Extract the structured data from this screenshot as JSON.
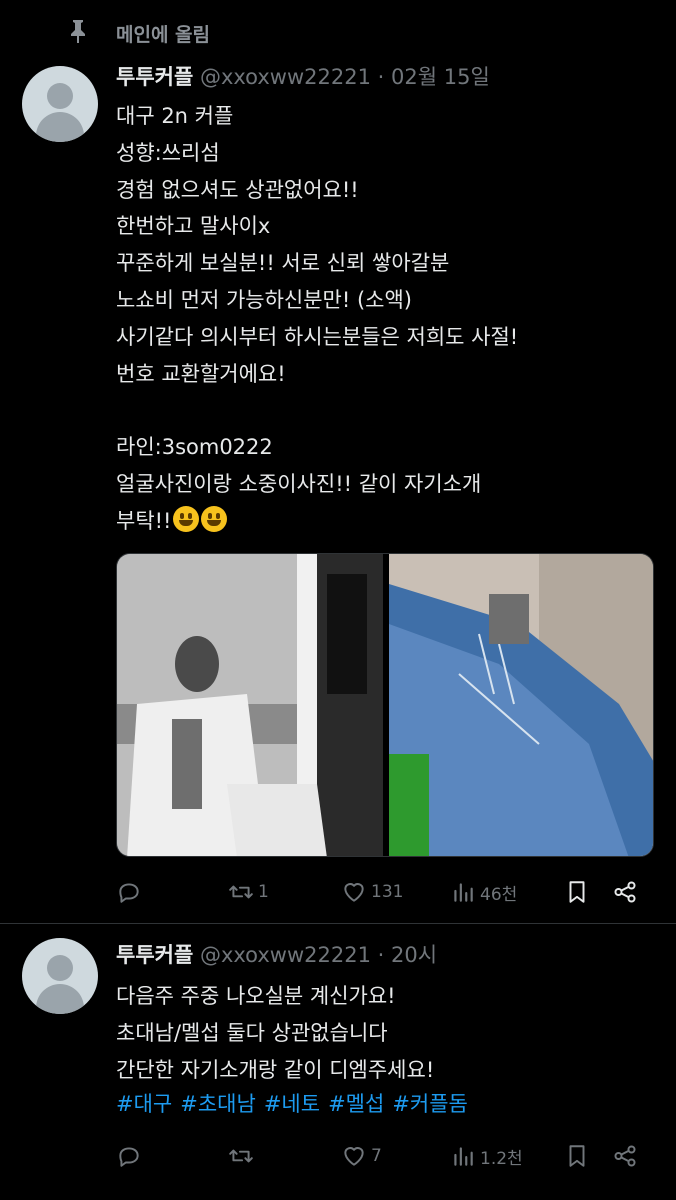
{
  "pinned": {
    "label": "메인에 올림"
  },
  "tweets": [
    {
      "display_name": "투투커플",
      "handle": "@xxoxww22221",
      "separator": "·",
      "time": "02월 15일",
      "lines": [
        "대구 2n 커플",
        "성향:쓰리섬",
        "경험 없으셔도 상관없어요!!",
        "한번하고 말사이x",
        "꾸준하게 보실분!! 서로 신뢰 쌓아갈분",
        "노쇼비 먼저 가능하신분만! (소액)",
        "사기같다 의시부터 하시는분들은 저희도 사절!",
        "번호 교환할거에요!",
        "",
        "라인:3som0222",
        "얼굴사진이랑 소중이사진!! 같이 자기소개",
        "부탁!!"
      ],
      "actions": {
        "reply": "",
        "retweet": "1",
        "like": "131",
        "views": "46천"
      }
    },
    {
      "display_name": "투투커플",
      "handle": "@xxoxww22221",
      "separator": "·",
      "time": "20시",
      "lines": [
        "다음주 주중 나오실분 계신가요!",
        "초대남/멜섭 둘다 상관없습니다",
        "간단한 자기소개랑 같이 디엠주세요!"
      ],
      "hashtags": [
        "#대구",
        "#초대남",
        "#네토",
        "#멜섭",
        "#커플돔"
      ],
      "actions": {
        "reply": "",
        "retweet": "",
        "like": "7",
        "views": "1.2천"
      }
    }
  ],
  "icons": {
    "pin": "pin-icon",
    "reply": "reply-icon",
    "retweet": "retweet-icon",
    "like": "heart-icon",
    "views": "views-icon",
    "bookmark": "bookmark-icon",
    "share": "share-icon"
  },
  "colors": {
    "background": "#000000",
    "text": "#e7e9ea",
    "secondary": "#71767b",
    "link": "#1d9bf0"
  }
}
